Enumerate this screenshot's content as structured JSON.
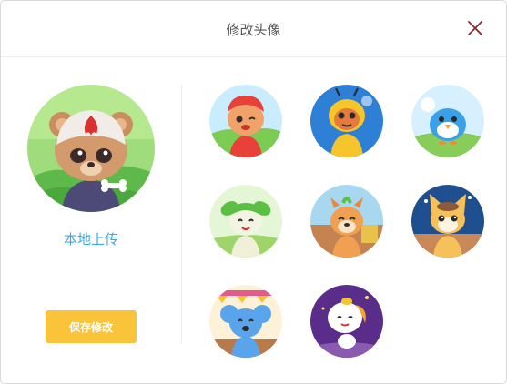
{
  "dialog": {
    "title": "修改头像",
    "close_icon": "close-icon"
  },
  "left": {
    "current_avatar": "bear-avatar",
    "upload_label": "本地上传",
    "save_label": "保存修改"
  },
  "colors": {
    "upload_link": "#3aa7e5",
    "save_button": "#f9c33a",
    "close_icon": "#8b2a2a"
  },
  "avatars": [
    {
      "name": "red-panda-avatar"
    },
    {
      "name": "bee-avatar"
    },
    {
      "name": "blue-bird-avatar"
    },
    {
      "name": "green-sprout-avatar"
    },
    {
      "name": "squirrel-avatar"
    },
    {
      "name": "fox-avatar"
    },
    {
      "name": "blue-koala-avatar"
    },
    {
      "name": "moon-spirit-avatar"
    }
  ]
}
